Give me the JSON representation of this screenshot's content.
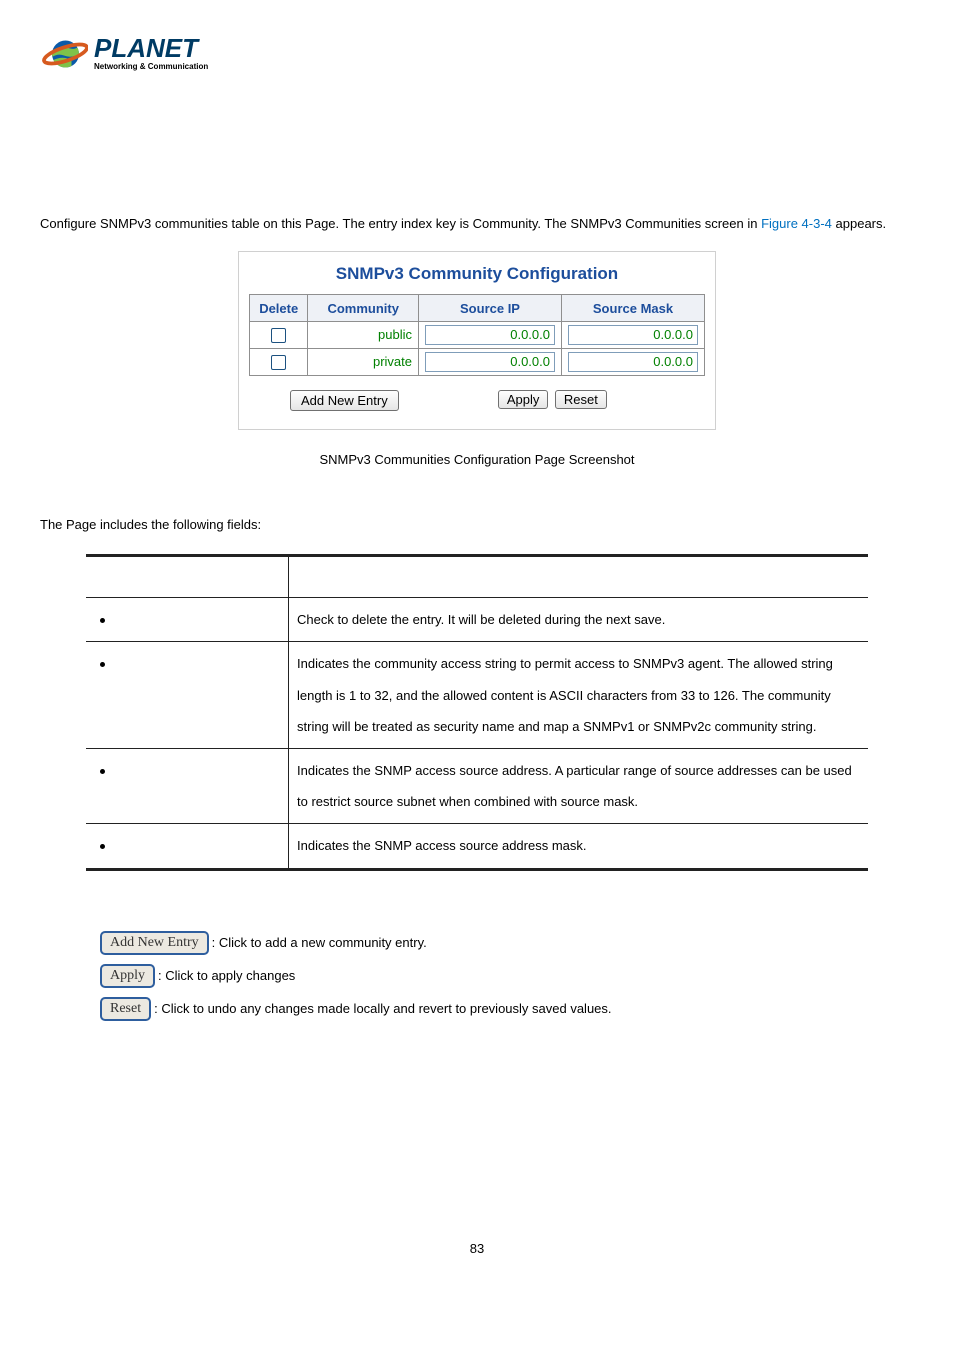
{
  "logo": {
    "brand": "PLANET",
    "tagline": "Networking & Communication"
  },
  "intro": {
    "line1_pre": "Configure SNMPv3 communities table on this Page. The entry index key is Community. The SNMPv3 Communities screen in ",
    "figure_ref": "Figure 4-3-4",
    "line1_post": " appears."
  },
  "config": {
    "title": "SNMPv3 Community Configuration",
    "headers": {
      "delete": "Delete",
      "community": "Community",
      "source_ip": "Source IP",
      "source_mask": "Source Mask"
    },
    "rows": [
      {
        "community": "public",
        "source_ip": "0.0.0.0",
        "source_mask": "0.0.0.0"
      },
      {
        "community": "private",
        "source_ip": "0.0.0.0",
        "source_mask": "0.0.0.0"
      }
    ],
    "buttons": {
      "add_new_entry": "Add New Entry",
      "apply": "Apply",
      "reset": "Reset"
    }
  },
  "caption": "SNMPv3 Communities Configuration Page Screenshot",
  "fields_intro": "The Page includes the following fields:",
  "fields": [
    {
      "label": "",
      "desc": ""
    },
    {
      "label": "",
      "desc": "Check to delete the entry. It will be deleted during the next save."
    },
    {
      "label": "",
      "desc": "Indicates the community access string to permit access to SNMPv3 agent. The allowed string length is 1 to 32, and the allowed content is ASCII characters from 33 to 126. The community string will be treated as security name and map a SNMPv1 or SNMPv2c community string."
    },
    {
      "label": "",
      "desc": "Indicates the SNMP access source address. A particular range of source addresses can be used to restrict source subnet when combined with source mask."
    },
    {
      "label": "",
      "desc": "Indicates the SNMP access source address mask."
    }
  ],
  "buttons_help": {
    "add_new_label": "Add New Entry",
    "add_new_text": ": Click to add a new community entry.",
    "apply_label": "Apply",
    "apply_text": ": Click to apply changes",
    "reset_label": "Reset",
    "reset_text": ": Click to undo any changes made locally and revert to previously saved values."
  },
  "page_number": "83"
}
